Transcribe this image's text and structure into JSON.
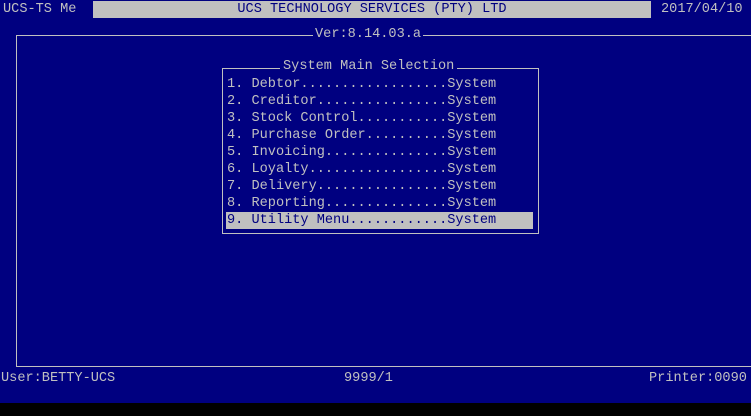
{
  "header": {
    "app_short": "UCS-TS Me",
    "company_title": "UCS TECHNOLOGY SERVICES (PTY) LTD",
    "date": "2017/04/10",
    "version": "Ver:8.14.03.a"
  },
  "menu": {
    "title": "System Main Selection",
    "items": [
      {
        "label": "1. Debtor..................System"
      },
      {
        "label": "2. Creditor................System"
      },
      {
        "label": "3. Stock Control...........System"
      },
      {
        "label": "4. Purchase Order..........System"
      },
      {
        "label": "5. Invoicing...............System"
      },
      {
        "label": "6. Loyalty.................System"
      },
      {
        "label": "7. Delivery................System"
      },
      {
        "label": "8. Reporting...............System"
      },
      {
        "label": "9. Utility Menu............System"
      }
    ],
    "selected_index": 8
  },
  "status": {
    "user": "User:BETTY-UCS",
    "terminal": "9999/1",
    "printer": "Printer:0090"
  },
  "colors": {
    "background": "#000080",
    "foreground": "#c0c0c0",
    "highlight": "#c0c0c0"
  }
}
